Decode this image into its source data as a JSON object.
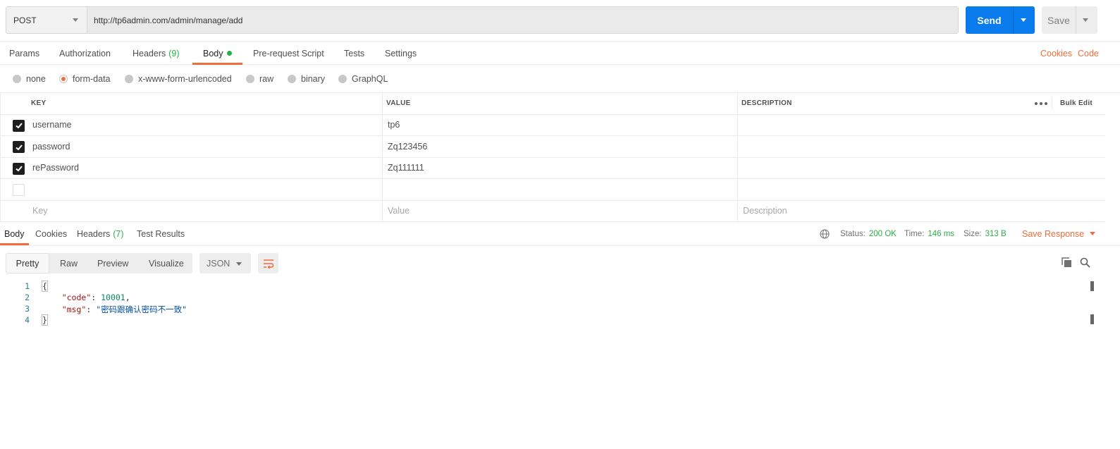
{
  "request": {
    "method": "POST",
    "url": "http://tp6admin.com/admin/manage/add",
    "send_label": "Send",
    "save_label": "Save"
  },
  "request_tabs": [
    {
      "label": "Params"
    },
    {
      "label": "Authorization"
    },
    {
      "label": "Headers",
      "count": "(9)"
    },
    {
      "label": "Body",
      "active": true
    },
    {
      "label": "Pre-request Script"
    },
    {
      "label": "Tests"
    },
    {
      "label": "Settings"
    }
  ],
  "right_links": {
    "cookies": "Cookies",
    "code": "Code"
  },
  "body_types": [
    {
      "label": "none"
    },
    {
      "label": "form-data",
      "selected": true
    },
    {
      "label": "x-www-form-urlencoded"
    },
    {
      "label": "raw"
    },
    {
      "label": "binary"
    },
    {
      "label": "GraphQL"
    }
  ],
  "params_table": {
    "headers": {
      "key": "KEY",
      "value": "VALUE",
      "description": "DESCRIPTION",
      "bulk_edit": "Bulk Edit"
    },
    "rows": [
      {
        "checked": true,
        "key": "username",
        "value": "tp6",
        "description": ""
      },
      {
        "checked": true,
        "key": "password",
        "value": "Zq123456",
        "description": ""
      },
      {
        "checked": true,
        "key": "rePassword",
        "value": "Zq111111",
        "description": ""
      },
      {
        "checked": false,
        "key": "",
        "value": "",
        "description": ""
      }
    ],
    "placeholders": {
      "key": "Key",
      "value": "Value",
      "description": "Description"
    }
  },
  "response_tabs": [
    {
      "label": "Body",
      "active": true
    },
    {
      "label": "Cookies"
    },
    {
      "label": "Headers",
      "count": "(7)"
    },
    {
      "label": "Test Results"
    }
  ],
  "response_meta": {
    "status_label": "Status:",
    "status_value": "200 OK",
    "time_label": "Time:",
    "time_value": "146 ms",
    "size_label": "Size:",
    "size_value": "313 B",
    "save_response": "Save Response"
  },
  "format_tabs": [
    {
      "label": "Pretty",
      "active": true
    },
    {
      "label": "Raw"
    },
    {
      "label": "Preview"
    },
    {
      "label": "Visualize"
    }
  ],
  "format_select": "JSON",
  "code_lines": [
    {
      "num": "1",
      "open": "{"
    },
    {
      "num": "2",
      "key": "\"code\"",
      "colon": ": ",
      "value": "10001",
      "tail": ","
    },
    {
      "num": "3",
      "key": "\"msg\"",
      "colon": ": ",
      "value": "\"密码跟确认密码不一致\"",
      "tail": ""
    },
    {
      "num": "4",
      "close": "}"
    }
  ],
  "colors": {
    "accent": "#f26b3a",
    "send": "#097bed",
    "success": "#26b047"
  },
  "icons": {
    "globe": "globe-icon",
    "copy": "copy-icon",
    "search": "search-icon",
    "wrap": "wrap-lines-icon",
    "more": "more-icon"
  }
}
